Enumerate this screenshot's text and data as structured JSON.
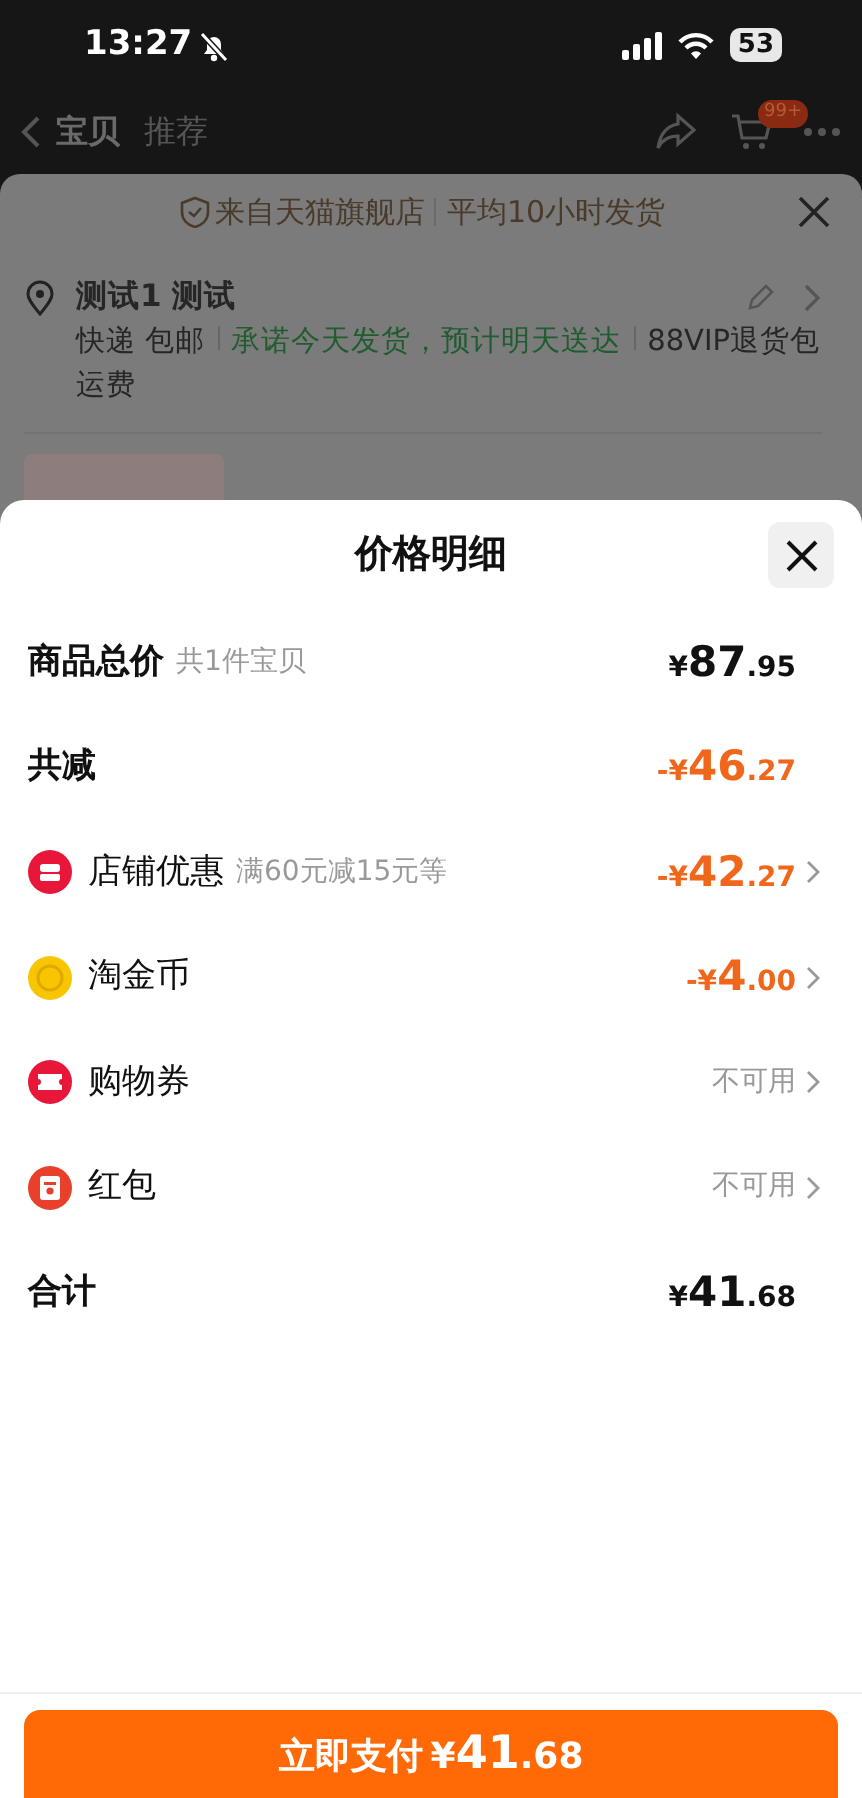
{
  "status_bar": {
    "time": "13:27",
    "battery": "53"
  },
  "nav": {
    "tabs": [
      {
        "label": "宝贝",
        "selected": true
      },
      {
        "label": "推荐",
        "selected": false
      }
    ],
    "cart_badge": "99+"
  },
  "background_panel": {
    "store": "来自天猫旗舰店",
    "shipping_time": "平均10小时发货",
    "address_name": "测试1 测试",
    "delivery": [
      {
        "text": "快递 包邮",
        "kind": "plain"
      },
      {
        "text": "承诺今天发货，预计明天送达",
        "kind": "promise"
      },
      {
        "text": "88VIP退货包运费",
        "kind": "plain"
      }
    ]
  },
  "sheet": {
    "title": "价格明细",
    "rows": [
      {
        "kind": "total",
        "label": "商品总价",
        "note": "共1件宝贝",
        "amount": {
          "prefix": "¥",
          "main": "87",
          "fraction": ".95"
        }
      },
      {
        "kind": "reduction",
        "label": "共减",
        "amount": {
          "prefix": "-¥",
          "main": "46",
          "fraction": ".27"
        }
      },
      {
        "kind": "store",
        "label": "店铺优惠",
        "note": "满60元减15元等",
        "amount": {
          "prefix": "-¥",
          "main": "42",
          "fraction": ".27"
        }
      },
      {
        "kind": "coin",
        "label": "淘金币",
        "amount": {
          "prefix": "-¥",
          "main": "4",
          "fraction": ".00"
        }
      },
      {
        "kind": "ticket",
        "label": "购物券",
        "status": "不可用"
      },
      {
        "kind": "envelope",
        "label": "红包",
        "status": "不可用"
      },
      {
        "kind": "total",
        "label": "合计",
        "amount": {
          "prefix": "¥",
          "main": "41",
          "fraction": ".68"
        }
      }
    ],
    "pay_button": {
      "label": "立即支付",
      "amount": {
        "prefix": "¥",
        "main": "41",
        "fraction": ".68"
      }
    }
  }
}
